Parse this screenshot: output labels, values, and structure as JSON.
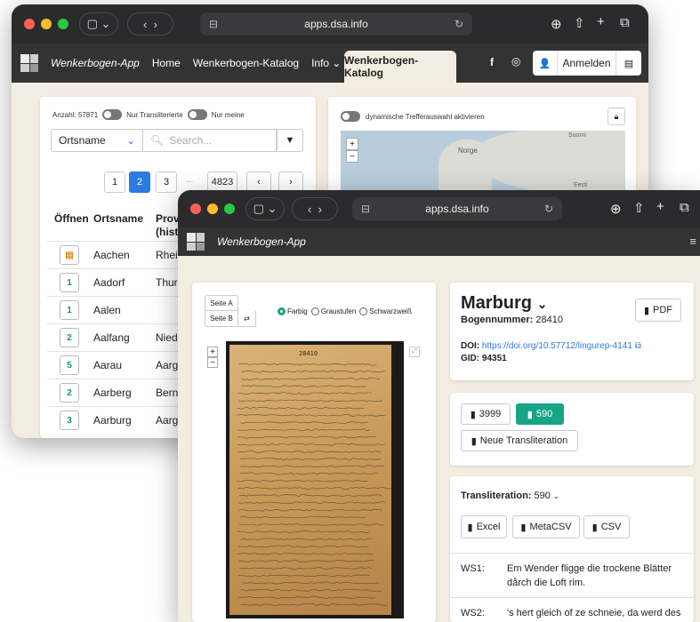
{
  "back_window": {
    "url": "apps.dsa.info",
    "nav": {
      "brand": "Wenkerbogen-App",
      "links": [
        "Home",
        "Wenkerbogen-Katalog",
        "Info"
      ],
      "active_tab": "Wenkerbogen-Katalog",
      "login": "Anmelden"
    },
    "list": {
      "count": "Anzahl: 57871",
      "toggle1": "Nur Transliterierte",
      "toggle2": "Nur meine",
      "select_value": "Ortsname",
      "search_placeholder": "Search...",
      "pages": [
        "1",
        "2",
        "3",
        "...",
        "4823"
      ],
      "active_page": "2",
      "columns": [
        "Öffnen",
        "Ortsname",
        "Provi",
        "(histo"
      ],
      "rows": [
        {
          "icon": "orange",
          "num": "",
          "name": "Aachen",
          "prov": "Rhein"
        },
        {
          "icon": "green",
          "num": "1",
          "name": "Aadorf",
          "prov": "Thurg"
        },
        {
          "icon": "green",
          "num": "1",
          "name": "Aalen",
          "prov": ""
        },
        {
          "icon": "green",
          "num": "2",
          "name": "Aalfang",
          "prov": "Niede"
        },
        {
          "icon": "green",
          "num": "5",
          "name": "Aarau",
          "prov": "Aarga"
        },
        {
          "icon": "green",
          "num": "2",
          "name": "Aarberg",
          "prov": "Bern"
        },
        {
          "icon": "green",
          "num": "3",
          "name": "Aarburg",
          "prov": "Aarga"
        }
      ]
    },
    "map": {
      "toggle_label": "dynamische Trefferauswahl aktivieren",
      "labels": [
        "Norge",
        "Suomi",
        "Eesti"
      ]
    }
  },
  "front_window": {
    "url": "apps.dsa.info",
    "brand": "Wenkerbogen-App",
    "viewer": {
      "page_a": "Seite A",
      "page_b": "Seite B",
      "color_options": [
        "Farbig",
        "Graustufen",
        "Schwarzweiß"
      ],
      "selected_color": "Farbig",
      "doc_number_stamp": "28410"
    },
    "details": {
      "title": "Marburg",
      "bogen_label": "Bogennummer:",
      "bogen_value": "28410",
      "pdf": "PDF",
      "doi_label": "DOI:",
      "doi_value": "https://doi.org/10.57712/lingurep-4141",
      "gid_label": "GID:",
      "gid_value": "94351"
    },
    "transliterations": {
      "btn1": "3999",
      "btn2": "590",
      "new": "Neue Transliteration"
    },
    "transliteration": {
      "label": "Transliteration:",
      "value": "590",
      "exports": [
        "Excel",
        "MetaCSV",
        "CSV"
      ],
      "sentences": [
        {
          "id": "WS1:",
          "line1": "Em Wender fligge die trockene Blätter",
          "line2": "dårch die Loft rim."
        },
        {
          "id": "WS2:",
          "line1": "'s hert gleich of ze schneie, da werd des",
          "line2": ""
        }
      ]
    }
  }
}
